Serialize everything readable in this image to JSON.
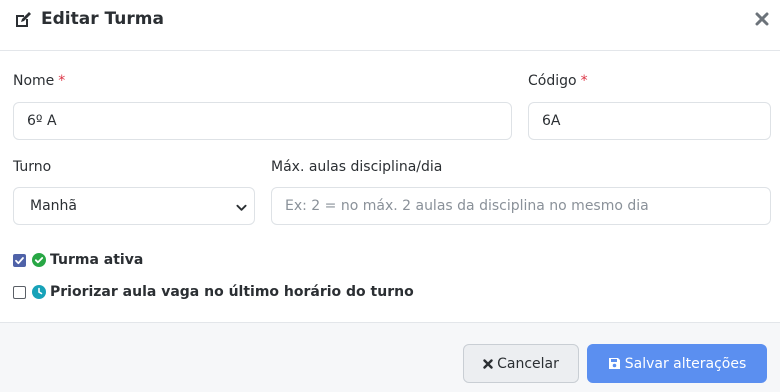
{
  "header": {
    "title": "Editar Turma"
  },
  "form": {
    "nome": {
      "label": "Nome",
      "required_mark": "*",
      "value": "6º A"
    },
    "codigo": {
      "label": "Código",
      "required_mark": "*",
      "value": "6A"
    },
    "turno": {
      "label": "Turno",
      "selected": "Manhã"
    },
    "max_aulas": {
      "label": "Máx. aulas disciplina/dia",
      "placeholder": "Ex: 2 = no máx. 2 aulas da disciplina no mesmo dia",
      "value": ""
    },
    "turma_ativa": {
      "label": "Turma ativa",
      "checked": true
    },
    "priorizar": {
      "label": "Priorizar aula vaga no último horário do turno",
      "checked": false
    }
  },
  "footer": {
    "cancel_label": "Cancelar",
    "save_label": "Salvar alterações"
  },
  "colors": {
    "primary": "#5b8ff0",
    "checkbox": "#4f62a8",
    "success": "#28a745",
    "info": "#17a2b8",
    "required": "#dc3545"
  }
}
